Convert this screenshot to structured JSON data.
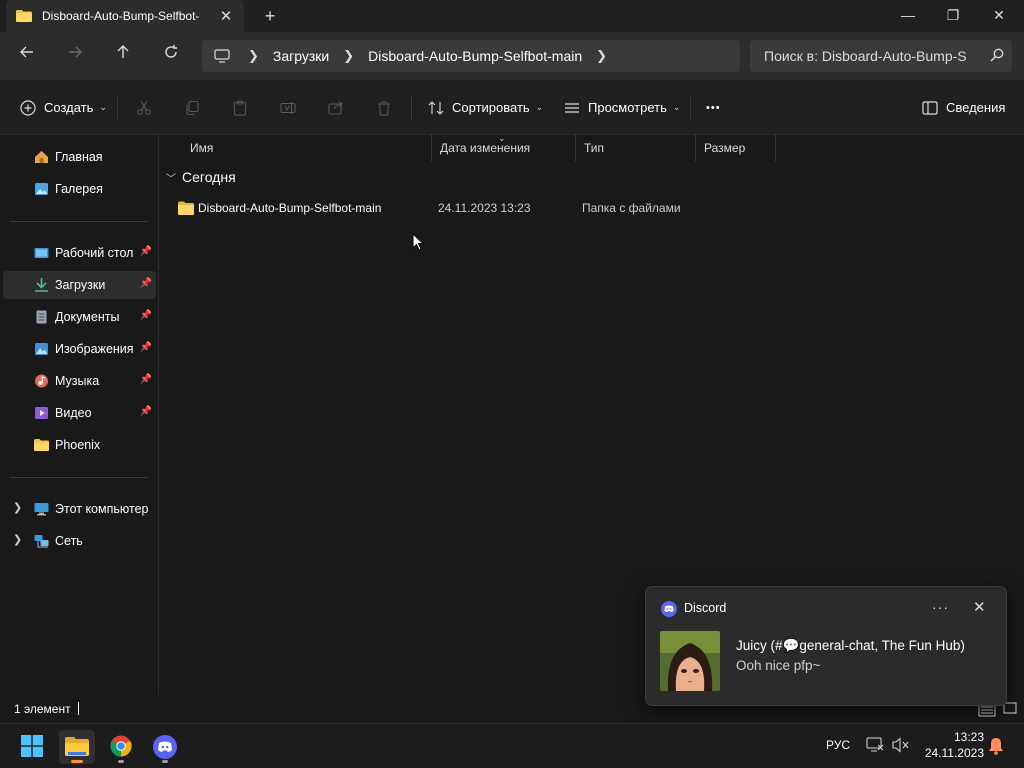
{
  "window": {
    "tab_title": "Disboard-Auto-Bump-Selfbot-",
    "tab_close": "✕",
    "new_tab": "+",
    "minimize": "—",
    "restore": "❐",
    "close": "✕"
  },
  "addressbar": {
    "breadcrumbs": [
      "Загрузки",
      "Disboard-Auto-Bump-Selfbot-main"
    ],
    "search_placeholder": "Поиск в: Disboard-Auto-Bump-S"
  },
  "commandbar": {
    "create_label": "Создать",
    "sort_label": "Сортировать",
    "view_label": "Просмотреть",
    "more_label": "•••",
    "details_label": "Сведения"
  },
  "sidebar": {
    "items": [
      {
        "label": "Главная",
        "icon": "home-icon",
        "color": "#e9a54b"
      },
      {
        "label": "Галерея",
        "icon": "gallery-icon",
        "color": "#4aa3e8"
      },
      {
        "label": "Рабочий стол",
        "icon": "desktop-icon",
        "color": "#3a9ad9",
        "pinned": true
      },
      {
        "label": "Загрузки",
        "icon": "download-icon",
        "color": "#4cc38a",
        "pinned": true,
        "active": true
      },
      {
        "label": "Документы",
        "icon": "document-icon",
        "color": "#9aa4b5",
        "pinned": true
      },
      {
        "label": "Изображения",
        "icon": "image-icon",
        "color": "#3d8fe0",
        "pinned": true
      },
      {
        "label": "Музыка",
        "icon": "music-icon",
        "color": "#e06d5a",
        "pinned": true
      },
      {
        "label": "Видео",
        "icon": "video-icon",
        "color": "#8a5ad8",
        "pinned": true
      },
      {
        "label": "Phoenix",
        "icon": "folder-icon",
        "color": "#f2c14e"
      },
      {
        "label": "Этот компьютер",
        "icon": "computer-icon",
        "color": "#3a9ad9"
      },
      {
        "label": "Сеть",
        "icon": "network-icon",
        "color": "#3a9ad9"
      }
    ]
  },
  "columns": [
    "Имя",
    "Дата изменения",
    "Тип",
    "Размер"
  ],
  "group_label": "Сегодня",
  "files": [
    {
      "name": "Disboard-Auto-Bump-Selfbot-main",
      "date": "24.11.2023 13:23",
      "type": "Папка с файлами",
      "size": ""
    }
  ],
  "status": {
    "count": "1 элемент"
  },
  "notification": {
    "app": "Discord",
    "title": "Juicy (#💬general-chat, The Fun Hub)",
    "body": "Ooh nice pfp~",
    "menu": "···",
    "close": "✕"
  },
  "taskbar": {
    "language": "РУС",
    "time": "13:23",
    "date": "24.11.2023"
  },
  "colors": {
    "accent": "#4cc2ff",
    "folder": "#f2c14e",
    "discord": "#5865f2"
  }
}
